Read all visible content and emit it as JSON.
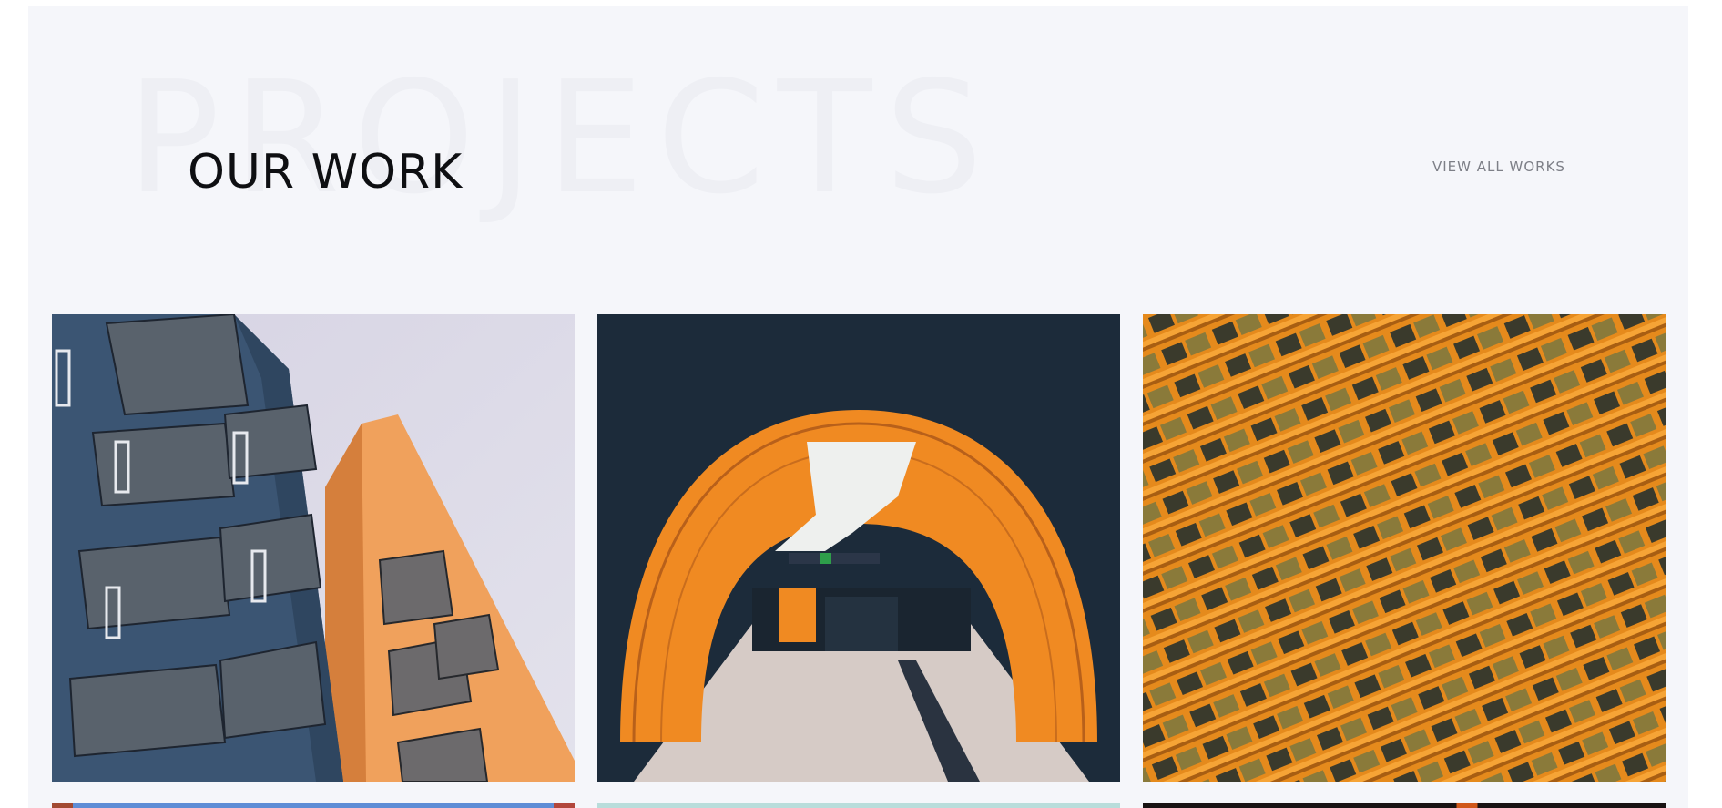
{
  "section": {
    "background_word": "PROJECTS",
    "title": "OUR WORK",
    "view_all_label": "VIEW ALL WORKS"
  },
  "colors": {
    "section_bg": "#f5f6fa",
    "title": "#0e0f12",
    "link": "#7d7f87",
    "accent_orange": "#f08a22",
    "navy": "#1c2b3a"
  },
  "projects": [
    {
      "image": "blue-orange-apartment-balconies-photo"
    },
    {
      "image": "orange-arched-subway-tunnel-photo"
    },
    {
      "image": "orange-facade-skyscraper-windows-photo"
    },
    {
      "image": "blue-sky-building-photo"
    },
    {
      "image": "mint-facade-photo"
    },
    {
      "image": "dark-orange-structure-photo"
    }
  ]
}
